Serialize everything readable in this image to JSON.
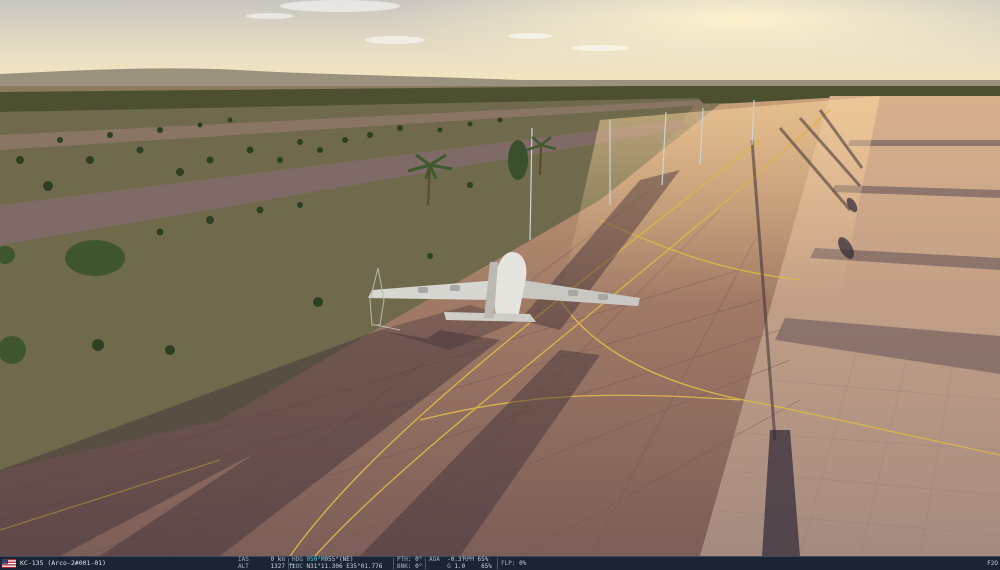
{
  "hud": {
    "unit_name": "KC-135 (Arco-2#001-01)",
    "ias_label": "IAS",
    "ias_value": "0 kn",
    "alt_label": "ALT",
    "alt_value": "1327 ft",
    "hdg_label": "HDG",
    "hdg_value_primary": "050°M",
    "hdg_value_secondary": "055°(NE)",
    "loc_label": "LOC",
    "loc_value": "N31°11.306 E35°01.776",
    "pth_label": "PTH",
    "pth_value": "0°",
    "bnk_label": "BNK",
    "bnk_value": "0°",
    "aoa_label": "AOA",
    "aoa_value": "-0.3°",
    "g_label": "G",
    "g_value": "1.0",
    "rpm_label": "RPM",
    "rpm_value_1": "65%",
    "rpm_value_2": "65%",
    "flp_label": "FLP",
    "flp_value": "0%",
    "fkey": "F2O"
  },
  "colors": {
    "hud_background": "#1b2433",
    "hud_accent": "#5ad1e6",
    "taxi_line": "#d9b64a"
  },
  "icons": {
    "flag": "us-flag-icon"
  }
}
